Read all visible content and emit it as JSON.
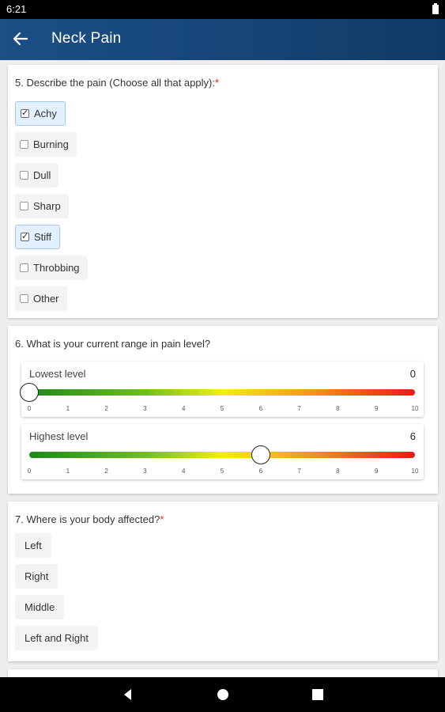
{
  "status_bar": {
    "time": "6:21"
  },
  "app_bar": {
    "title": "Neck Pain"
  },
  "q5": {
    "number": "5.",
    "text": "Describe the pain (Choose all that apply):",
    "required_mark": "*",
    "options": [
      {
        "label": "Achy",
        "checked": true
      },
      {
        "label": "Burning",
        "checked": false
      },
      {
        "label": "Dull",
        "checked": false
      },
      {
        "label": "Sharp",
        "checked": false
      },
      {
        "label": "Stiff",
        "checked": true
      },
      {
        "label": "Throbbing",
        "checked": false
      },
      {
        "label": "Other",
        "checked": false
      }
    ]
  },
  "q6": {
    "number": "6.",
    "text": "What is your current range in pain level?",
    "sliders": [
      {
        "label": "Lowest level",
        "value": "0",
        "level": 0
      },
      {
        "label": "Highest level",
        "value": "6",
        "level": 6
      }
    ],
    "ticks": [
      "0",
      "1",
      "2",
      "3",
      "4",
      "5",
      "6",
      "7",
      "8",
      "9",
      "10"
    ],
    "scale_min": 0,
    "scale_max": 10
  },
  "q7": {
    "number": "7.",
    "text": "Where is your body affected?",
    "required_mark": "*",
    "options": [
      "Left",
      "Right",
      "Middle",
      "Left and Right"
    ]
  },
  "colors": {
    "app_bar": "#164577",
    "checked_chip": "#e3f0ff",
    "required": "#e02424",
    "gradient": [
      "#1b8a1b",
      "#f2ee16",
      "#e81818"
    ]
  },
  "icons": {
    "back": "arrow-left-icon",
    "nav_back": "triangle-back-icon",
    "nav_home": "circle-home-icon",
    "nav_recents": "square-recents-icon"
  }
}
